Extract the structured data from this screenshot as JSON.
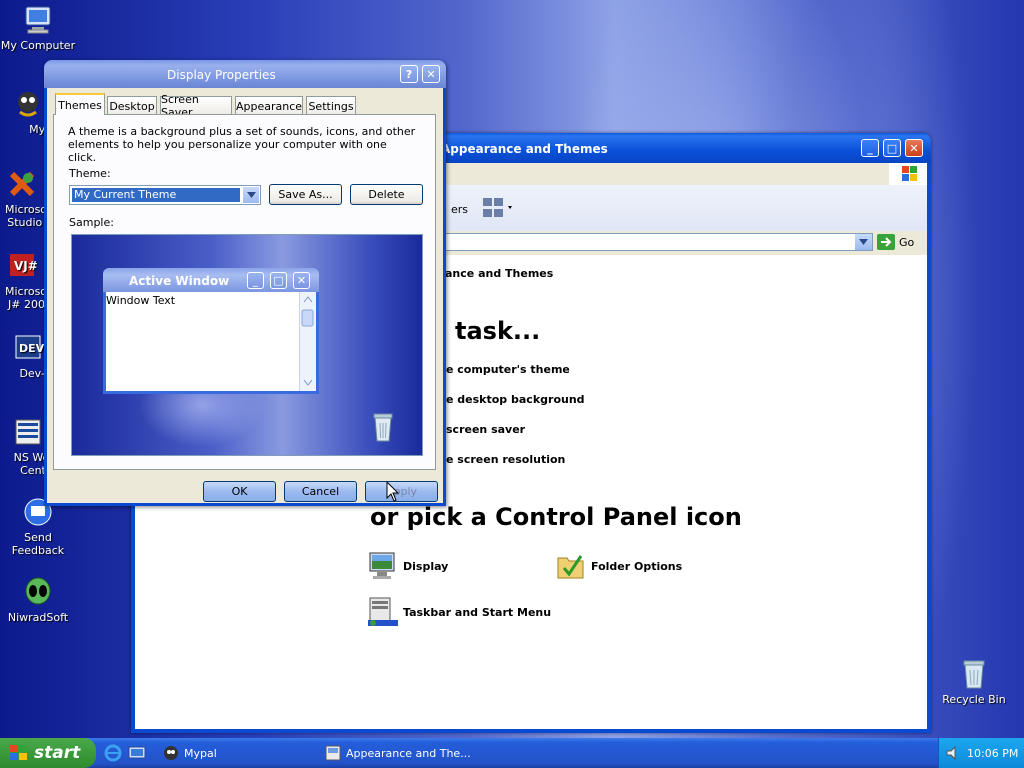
{
  "desktop": {
    "icons": [
      {
        "label": "My Computer"
      },
      {
        "label": "MyPa"
      },
      {
        "label": "Microsoft Studio 2"
      },
      {
        "label": "Microsoft J# 2005"
      },
      {
        "label": "Dev-C"
      },
      {
        "label": "NS Wel Cent"
      },
      {
        "label": "Send Feedback"
      },
      {
        "label": "NiwradSoft"
      },
      {
        "label": "Recycle Bin"
      }
    ]
  },
  "control_panel": {
    "title": "Appearance and Themes",
    "toolbar_label": "ers",
    "go_label": "Go",
    "breadcrumb": "ance and Themes",
    "heading_task": "task...",
    "tasks": [
      {
        "label": "e computer's theme"
      },
      {
        "label": "e desktop background"
      },
      {
        "label": "screen saver"
      },
      {
        "label": "e screen resolution"
      }
    ],
    "heading_icon": "or pick a Control Panel icon",
    "icons": [
      {
        "label": "Display"
      },
      {
        "label": "Folder Options"
      },
      {
        "label": "Taskbar and Start Menu"
      }
    ]
  },
  "dialog": {
    "title": "Display Properties",
    "tabs": [
      "Themes",
      "Desktop",
      "Screen Saver",
      "Appearance",
      "Settings"
    ],
    "description": "A theme is a background plus a set of sounds, icons, and other elements to help you personalize your computer with one click.",
    "theme_label": "Theme:",
    "theme_value": "My Current Theme",
    "save_as_label": "Save As...",
    "delete_label": "Delete",
    "sample_label": "Sample:",
    "sample_window_title": "Active Window",
    "sample_window_text": "Window Text",
    "ok_label": "OK",
    "cancel_label": "Cancel",
    "apply_label": "Apply"
  },
  "taskbar": {
    "start_label": "start",
    "items": [
      {
        "label": "Mypal"
      },
      {
        "label": "Appearance and The..."
      }
    ],
    "clock": "10:06 PM"
  }
}
